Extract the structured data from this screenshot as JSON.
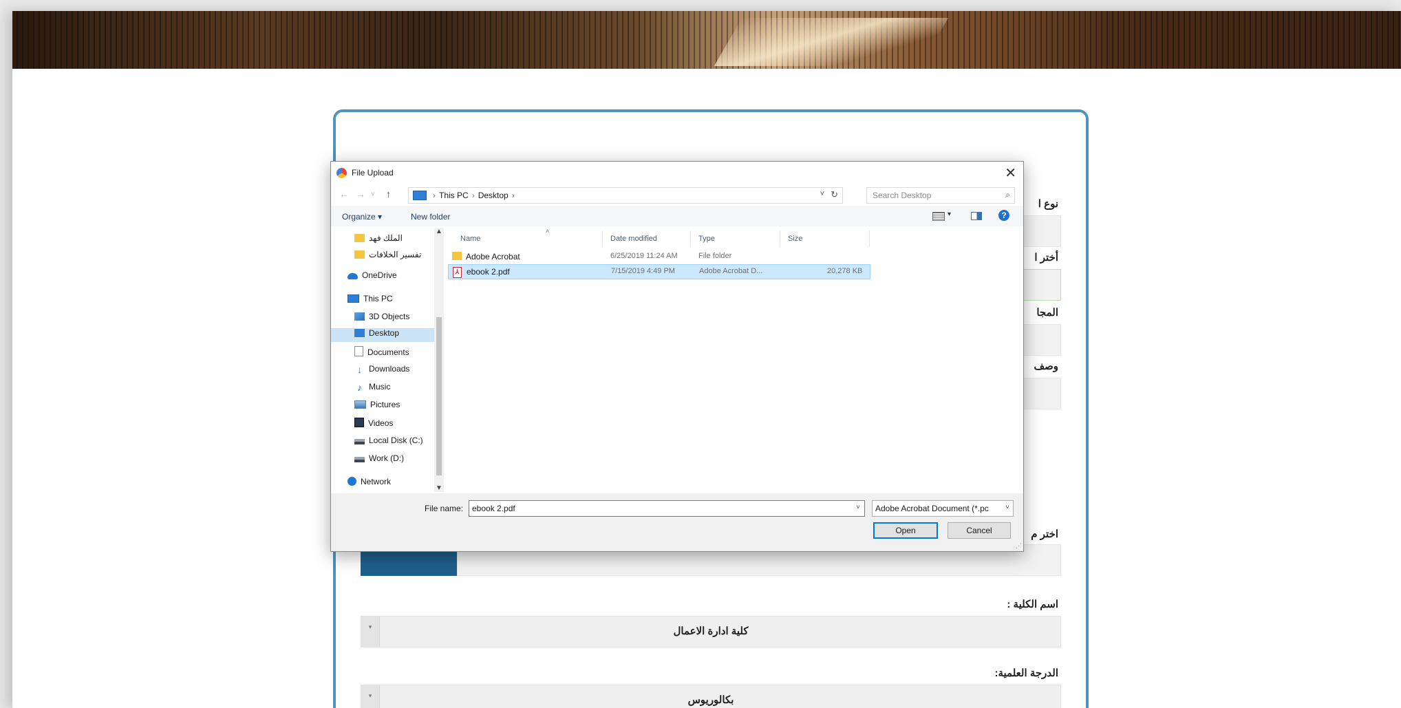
{
  "form": {
    "heading_partial": "",
    "labels": {
      "type": "نوع ا",
      "choose": "أختر ا",
      "field": "المجا",
      "description": "وصف",
      "choose_file": "اختر م",
      "college": "اسم الكلية :",
      "degree": "الدرجة العلمية:"
    },
    "college_value": "كلية ادارة الاعمال",
    "degree_value": "بكالوريوس"
  },
  "dialog": {
    "title": "File Upload",
    "breadcrumb": [
      "This PC",
      "Desktop"
    ],
    "search_placeholder": "Search Desktop",
    "toolbar": {
      "organize": "Organize ▾",
      "new_folder": "New folder"
    },
    "nav_items": [
      {
        "label": "الملك فهد",
        "icon": "folder-icon"
      },
      {
        "label": "تفسير الخلافات",
        "icon": "folder-icon"
      },
      {
        "label": "OneDrive",
        "icon": "cloud-icon"
      },
      {
        "label": "This PC",
        "icon": "computer-icon"
      },
      {
        "label": "3D Objects",
        "icon": "cube-icon"
      },
      {
        "label": "Desktop",
        "icon": "desktop-icon"
      },
      {
        "label": "Documents",
        "icon": "document-icon"
      },
      {
        "label": "Downloads",
        "icon": "download-icon"
      },
      {
        "label": "Music",
        "icon": "music-icon"
      },
      {
        "label": "Pictures",
        "icon": "pictures-icon"
      },
      {
        "label": "Videos",
        "icon": "video-icon"
      },
      {
        "label": "Local Disk (C:)",
        "icon": "disk-icon"
      },
      {
        "label": "Work (D:)",
        "icon": "disk-icon"
      },
      {
        "label": "Network",
        "icon": "network-icon"
      }
    ],
    "columns": [
      "Name",
      "Date modified",
      "Type",
      "Size"
    ],
    "files": [
      {
        "name": "Adobe Acrobat",
        "date": "6/25/2019 11:24 AM",
        "type": "File folder",
        "size": ""
      },
      {
        "name": "ebook 2.pdf",
        "date": "7/15/2019 4:49 PM",
        "type": "Adobe Acrobat D...",
        "size": "20,278 KB"
      }
    ],
    "filename_label": "File name:",
    "filename_value": "ebook 2.pdf",
    "filetype_value": "Adobe Acrobat Document (*.pc",
    "open_label": "Open",
    "cancel_label": "Cancel"
  }
}
